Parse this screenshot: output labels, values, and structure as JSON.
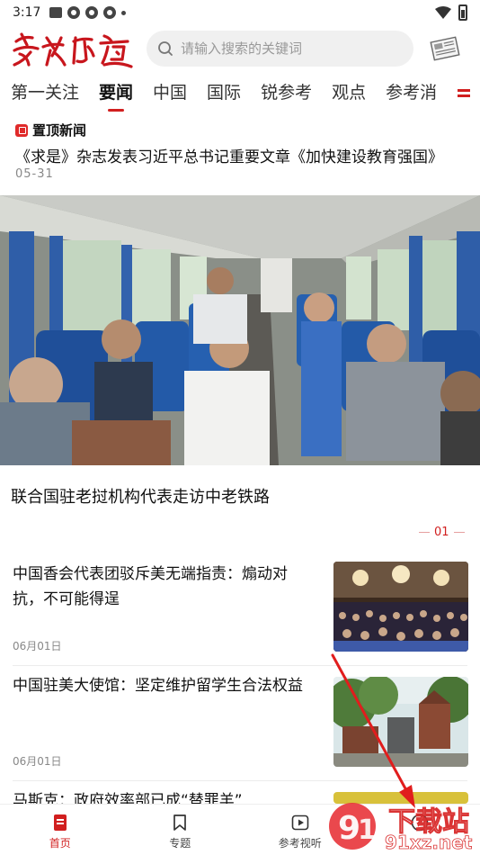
{
  "status_bar": {
    "time": "3:17"
  },
  "header": {
    "logo_text": "参考消息",
    "search_placeholder": "请输入搜索的关键词"
  },
  "tabs": [
    {
      "label": "第一关注",
      "active": false
    },
    {
      "label": "要闻",
      "active": true
    },
    {
      "label": "中国",
      "active": false
    },
    {
      "label": "国际",
      "active": false
    },
    {
      "label": "锐参考",
      "active": false
    },
    {
      "label": "观点",
      "active": false
    },
    {
      "label": "参考消",
      "active": false
    }
  ],
  "pinned": {
    "label": "置顶新闻",
    "title": "《求是》杂志发表习近平总书记重要文章《加快建设教育强国》",
    "date": "05-31"
  },
  "hero": {
    "caption": "联合国驻老挝机构代表走访中老铁路",
    "page_indicator": "01"
  },
  "news": [
    {
      "title": "中国香会代表团驳斥美无端指责：煽动对抗，不可能得逞",
      "date": "06月01日"
    },
    {
      "title": "中国驻美大使馆：坚定维护留学生合法权益",
      "date": "06月01日"
    },
    {
      "title": "马斯克：政府效率部已成“替罪羊”",
      "date": ""
    }
  ],
  "bottom_nav": [
    {
      "label": "首页",
      "icon": "home-icon",
      "active": true
    },
    {
      "label": "专题",
      "icon": "bookmark-icon",
      "active": false
    },
    {
      "label": "参考视听",
      "icon": "play-icon",
      "active": false
    },
    {
      "label": "",
      "icon": "profile-icon",
      "active": false
    }
  ],
  "watermark": {
    "text": "下载站",
    "domain": "91xz.net"
  },
  "colors": {
    "accent": "#d11f1f",
    "text": "#111111",
    "muted": "#888888"
  }
}
